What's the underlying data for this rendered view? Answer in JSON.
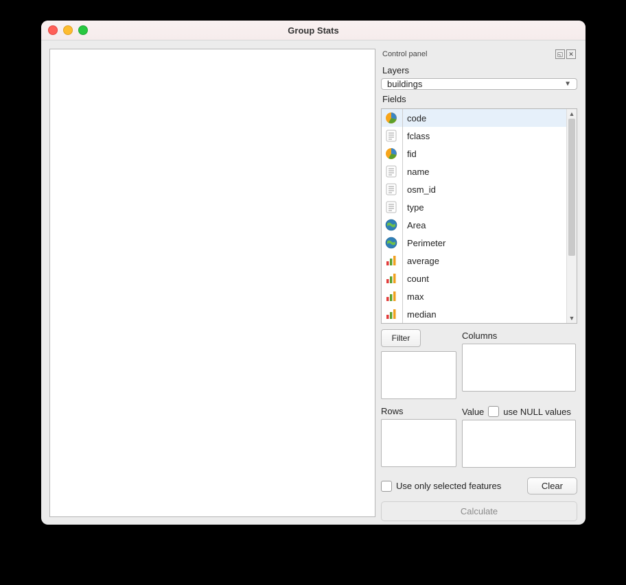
{
  "window": {
    "title": "Group Stats"
  },
  "panel": {
    "title": "Control panel",
    "layers_label": "Layers",
    "layer_selected": "buildings",
    "fields_label": "Fields",
    "fields": [
      {
        "label": "code",
        "icon": "pie",
        "selected": true
      },
      {
        "label": "fclass",
        "icon": "text",
        "selected": false
      },
      {
        "label": "fid",
        "icon": "pie",
        "selected": false
      },
      {
        "label": "name",
        "icon": "text",
        "selected": false
      },
      {
        "label": "osm_id",
        "icon": "text",
        "selected": false
      },
      {
        "label": "type",
        "icon": "text",
        "selected": false
      },
      {
        "label": "Area",
        "icon": "globe",
        "selected": false
      },
      {
        "label": "Perimeter",
        "icon": "globe",
        "selected": false
      },
      {
        "label": "average",
        "icon": "bars",
        "selected": false
      },
      {
        "label": "count",
        "icon": "bars",
        "selected": false
      },
      {
        "label": "max",
        "icon": "bars",
        "selected": false
      },
      {
        "label": "median",
        "icon": "bars",
        "selected": false
      }
    ],
    "filter_label": "Filter",
    "columns_label": "Columns",
    "rows_label": "Rows",
    "value_label": "Value",
    "use_null_label": "use NULL values",
    "use_only_selected_label": "Use only selected features",
    "clear_label": "Clear",
    "calculate_label": "Calculate"
  }
}
